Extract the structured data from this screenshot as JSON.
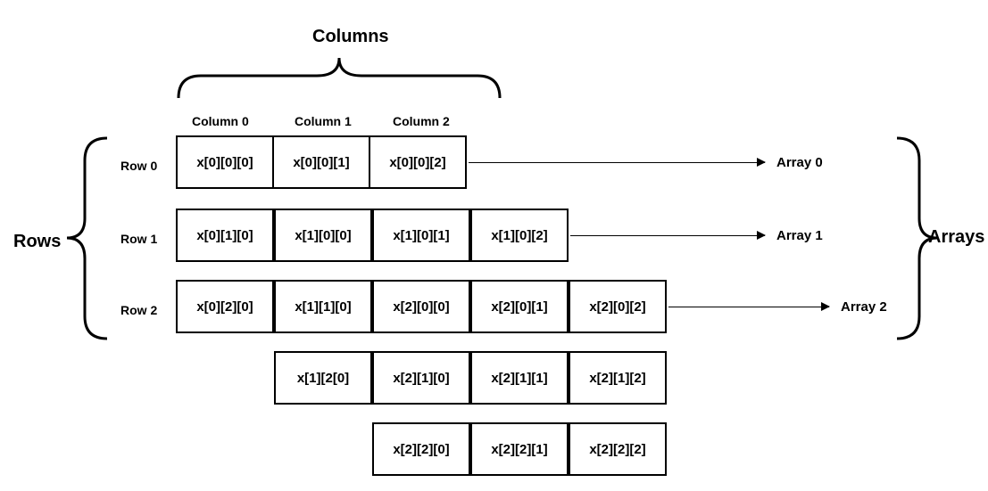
{
  "labels": {
    "columns": "Columns",
    "rows": "Rows",
    "arrays": "Arrays",
    "col0": "Column 0",
    "col1": "Column 1",
    "col2": "Column 2",
    "row0": "Row 0",
    "row1": "Row 1",
    "row2": "Row 2",
    "arr0": "Array 0",
    "arr1": "Array 1",
    "arr2": "Array 2"
  },
  "layer0": {
    "cells": [
      [
        "x[0][0][0]",
        "x[0][0][1]",
        "x[0][0][2]"
      ],
      [
        "x[0][1][0]",
        "",
        ""
      ],
      [
        "x[0][2][0]",
        "",
        ""
      ]
    ]
  },
  "layer1": {
    "cells": [
      [
        "x[1][0][0]",
        "x[1][0][1]",
        "x[1][0][2]"
      ],
      [
        "x[1][1][0]",
        "",
        ""
      ],
      [
        "x[1][2[0]",
        "",
        ""
      ]
    ]
  },
  "layer2": {
    "cells": [
      [
        "x[2][0][0]",
        "x[2][0][1]",
        "x[2][0][2]"
      ],
      [
        "x[2][1][0]",
        "x[2][1][1]",
        "x[2][1][2]"
      ],
      [
        "x[2][2][0]",
        "x[2][2][1]",
        "x[2][2][2]"
      ]
    ]
  }
}
